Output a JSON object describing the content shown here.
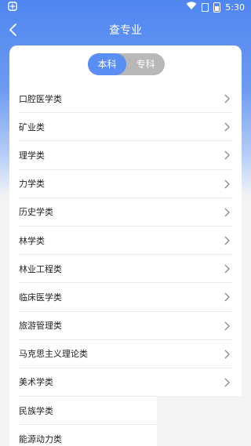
{
  "status": {
    "time": "5:30",
    "battery": "5"
  },
  "header": {
    "title": "查专业"
  },
  "toggle": {
    "options": [
      "本科",
      "专科"
    ],
    "active": "本科"
  },
  "categories": [
    "口腔医学类",
    "矿业类",
    "理学类",
    "力学类",
    "历史学类",
    "林学类",
    "林业工程类",
    "临床医学类",
    "旅游管理类",
    "马克思主义理论类",
    "美术学类",
    "民族学类",
    "能源动力类"
  ],
  "colors": {
    "accent": "#5a8ef2",
    "inactive": "#b8b8b8"
  }
}
